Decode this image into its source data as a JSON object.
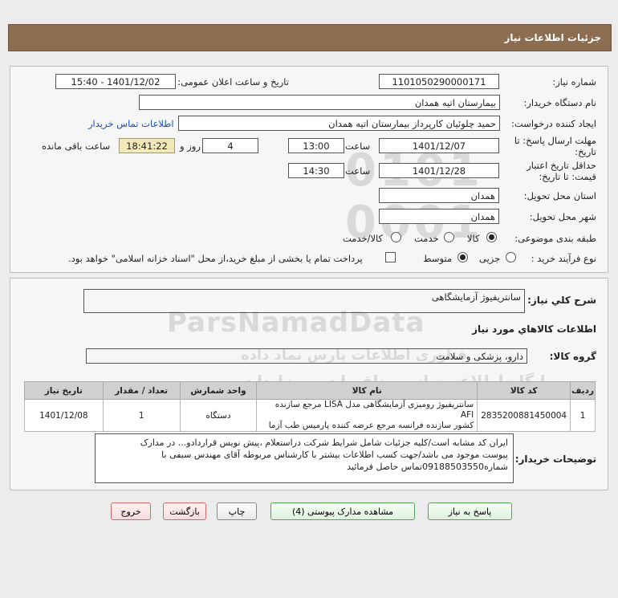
{
  "header": {
    "title": "جزئیات اطلاعات نیاز"
  },
  "form": {
    "need_number": {
      "label": "شماره نیاز:",
      "value": "1101050290000171"
    },
    "announce": {
      "label": "تاریخ و ساعت اعلان عمومی:",
      "value": "1401/12/02 - 15:40"
    },
    "buyer_org": {
      "label": "نام دستگاه خریدار:",
      "value": "بیمارستان اتیه همدان"
    },
    "creator": {
      "label": "ایجاد کننده درخواست:",
      "value": "حمید چلوئیان  کارپرداز بیمارستان اتیه همدان",
      "contact_link": "اطلاعات تماس خریدار"
    },
    "deadline": {
      "label_line1": "مهلت ارسال پاسخ: تا",
      "label_line2": "تاریخ:",
      "date": "1401/12/07",
      "time_label": "ساعت",
      "time": "13:00",
      "days": "4",
      "days_label": "روز و",
      "remaining": "18:41:22",
      "remaining_label": "ساعت باقی مانده"
    },
    "validity": {
      "label_line1": "حداقل تاریخ اعتبار",
      "label_line2": "قیمت: تا تاریخ:",
      "date": "1401/12/28",
      "time_label": "ساعت",
      "time": "14:30"
    },
    "province": {
      "label": "استان محل تحویل:",
      "value": "همدان"
    },
    "city": {
      "label": "شهر محل تحویل:",
      "value": "همدان"
    },
    "category": {
      "label": "طبقه بندی موضوعی:",
      "options": [
        "کالا",
        "خدمت",
        "کالا/خدمت"
      ],
      "selected": "کالا"
    },
    "process": {
      "label": "نوع فرآیند خرید :",
      "options": [
        "جزیی",
        "متوسط"
      ],
      "selected": "متوسط",
      "payment_note": "پرداخت تمام یا بخشی از مبلغ خرید،از محل \"اسناد خزانه اسلامی\" خواهد بود."
    }
  },
  "summary": {
    "label": "شرح کلي نياز:",
    "value": "سانتریفیوژ آزمایشگاهی",
    "goods_heading": "اطلاعات کالاهاي مورد نياز",
    "group_label": "گروه کالا:",
    "group_value": "دارو، پزشکی و سلامت"
  },
  "table": {
    "headers": [
      "ردیف",
      "کد کالا",
      "نام کالا",
      "واحد شمارش",
      "تعداد / مقدار",
      "تاریخ نیاز"
    ],
    "rows": [
      {
        "row": "1",
        "code": "2835200881450004",
        "name_line1": "سانتریفیوژ رومیزی آزمایشگاهی مدل LISA مرجع سازنده AFI",
        "name_line2": "کشور سازنده فرانسه مرجع عرضه کننده پارمیس طب آزما",
        "unit": "دستگاه",
        "qty": "1",
        "date": "1401/12/08"
      }
    ]
  },
  "buyer_notes": {
    "label": "توضیحات خریدار:",
    "line1": "ایران کد مشابه است/کلیه جزئیات شامل شرایط شرکت دراستعلام ،پیش نویس قراردادو... در مدارک",
    "line2": "پیوست موجود می باشد/جهت کسب اطلاعات بیشتر با کارشناس مربوطه آقای مهندس سیفی با",
    "line3": "شماره09188503550تماس حاصل فرمائید"
  },
  "buttons": {
    "reply": "پاسخ به نیاز",
    "attachments": "مشاهده مدارک پیوستی (4)",
    "print": "چاپ",
    "back": "بازگشت",
    "exit": "خروج"
  },
  "watermark": {
    "brand": "ParsNamadData",
    "tagline": "پایگاه اطلاع رسانی مناقصات و مزایدات",
    "sub": "فناوری اطلاعات پارس نماد داده"
  }
}
